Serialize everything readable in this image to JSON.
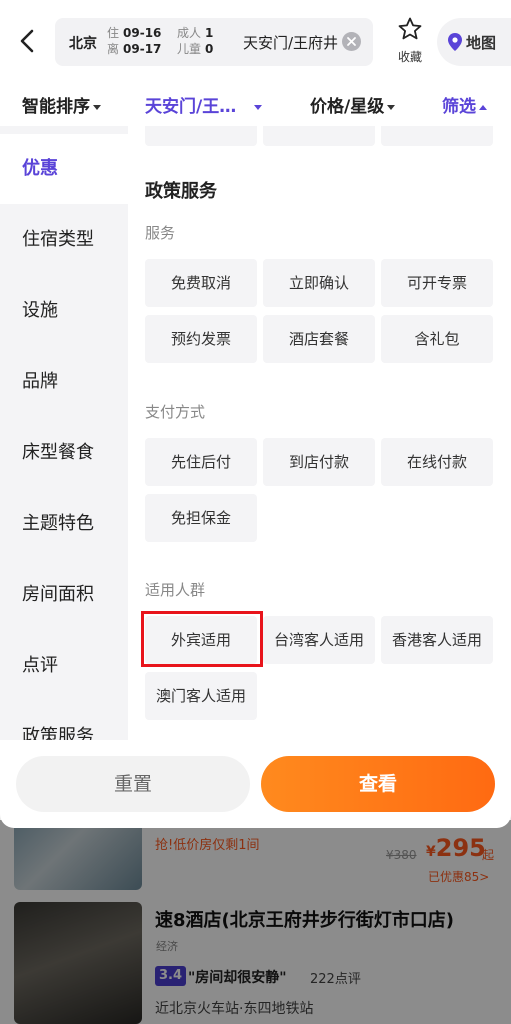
{
  "header": {
    "city": "北京",
    "checkin_label": "住",
    "checkin_date": "09-16",
    "checkout_label": "离",
    "checkout_date": "09-17",
    "adults_label": "成人",
    "adults": "1",
    "children_label": "儿童",
    "children": "0",
    "keyword": "天安门/王府井",
    "favorite_label": "收藏",
    "map_label": "地图"
  },
  "filter_bar": {
    "sort": "智能排序",
    "location": "天安门/王…",
    "price_star": "价格/星级",
    "filter": "筛选"
  },
  "sidebar": {
    "items": [
      "优惠",
      "住宿类型",
      "设施",
      "品牌",
      "床型餐食",
      "主题特色",
      "房间面积",
      "点评",
      "政策服务"
    ],
    "active_index": 0
  },
  "policy": {
    "title": "政策服务",
    "groups": [
      {
        "label": "服务",
        "options": [
          "免费取消",
          "立即确认",
          "可开专票",
          "预约发票",
          "酒店套餐",
          "含礼包"
        ]
      },
      {
        "label": "支付方式",
        "options": [
          "先住后付",
          "到店付款",
          "在线付款",
          "免担保金"
        ]
      },
      {
        "label": "适用人群",
        "options": [
          "外宾适用",
          "台湾客人适用",
          "香港客人适用",
          "澳门客人适用"
        ]
      }
    ]
  },
  "actions": {
    "reset": "重置",
    "view": "查看"
  },
  "background_list": {
    "hotel_a": {
      "deal": "抢!低价房仅剩1间",
      "original_price": "¥380",
      "price_symbol": "¥",
      "price": "295",
      "unit": "起",
      "saved": "已优惠85>"
    },
    "hotel_b": {
      "name": "速8酒店(北京王府井步行街灯市口店)",
      "level": "经济",
      "score": "3.4",
      "quote": "\"房间却很安静\"",
      "reviews": "222点评",
      "location": "近北京火车站·东四地铁站"
    }
  },
  "colors": {
    "accent": "#5a44d8",
    "orange": "#ff6a12",
    "highlight_box": "#e8141b"
  }
}
